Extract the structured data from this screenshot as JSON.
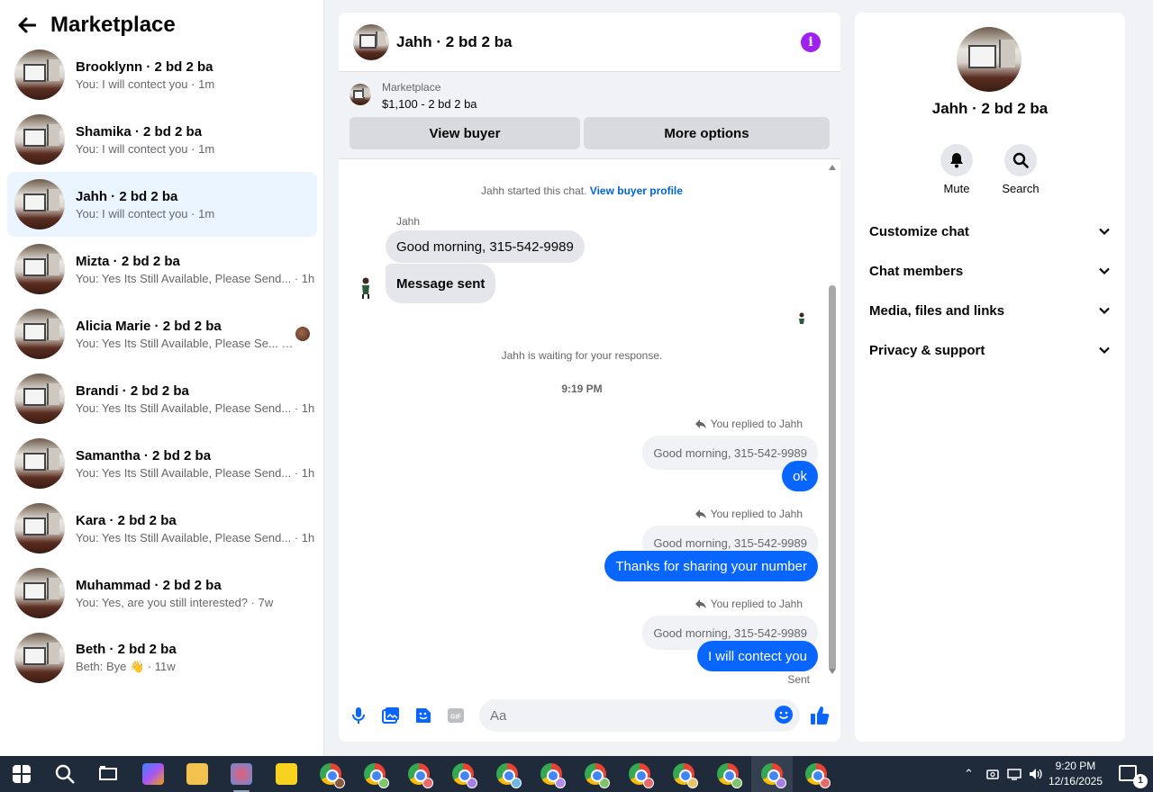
{
  "sidebar": {
    "title": "Marketplace",
    "conversations": [
      {
        "name": "Brooklynn · 2 bd 2 ba",
        "snippet": "You: I will contect you · 1m"
      },
      {
        "name": "Shamika · 2 bd 2 ba",
        "snippet": "You: I will contect you · 1m"
      },
      {
        "name": "Jahh · 2 bd 2 ba",
        "snippet": "You: I will contect you · 1m"
      },
      {
        "name": "Mizta · 2 bd 2 ba",
        "snippet": "You: Yes Its Still Available, Please Send... · 1h"
      },
      {
        "name": "Alicia Marie · 2 bd 2 ba",
        "snippet": "You: Yes Its Still Available, Please Se... · 1h"
      },
      {
        "name": "Brandi · 2 bd 2 ba",
        "snippet": "You: Yes Its Still Available, Please Send... · 1h"
      },
      {
        "name": "Samantha · 2 bd 2 ba",
        "snippet": "You: Yes Its Still Available, Please Send... · 1h"
      },
      {
        "name": "Kara · 2 bd 2 ba",
        "snippet": "You: Yes Its Still Available, Please Send... · 1h"
      },
      {
        "name": "Muhammad · 2 bd 2 ba",
        "snippet": "You: Yes, are you still interested? · 7w"
      },
      {
        "name": "Beth · 2 bd 2 ba",
        "snippet": "Beth: Bye 👋 · 11w"
      }
    ]
  },
  "chat": {
    "title": "Jahh · 2 bd 2 ba",
    "listing": {
      "label": "Marketplace",
      "price": "$1,100 - 2 bd 2 ba",
      "view_buyer": "View buyer",
      "more_options": "More options"
    },
    "started_text": "Jahh started this chat.",
    "view_profile": "View buyer profile",
    "sender_name": "Jahh",
    "incoming": [
      "Good morning, 315-542-9989",
      "Message sent"
    ],
    "waiting_text": "Jahh is waiting for your response.",
    "timestamp": "9:19 PM",
    "replied_label": "You replied to Jahh",
    "quoted": "Good morning, 315-542-9989",
    "outgoing": [
      "ok",
      "Thanks for sharing your number",
      "I will contect you"
    ],
    "sent_status": "Sent",
    "composer_placeholder": "Aa"
  },
  "details": {
    "name": "Jahh · 2 bd 2 ba",
    "mute_label": "Mute",
    "search_label": "Search",
    "sections": [
      "Customize chat",
      "Chat members",
      "Media, files and links",
      "Privacy & support"
    ]
  },
  "taskbar": {
    "time": "9:20 PM",
    "date": "12/16/2025",
    "notification_count": "1"
  },
  "colors": {
    "accent": "#0866ff",
    "info": "#a020f0",
    "active_row": "#ebf5ff"
  }
}
